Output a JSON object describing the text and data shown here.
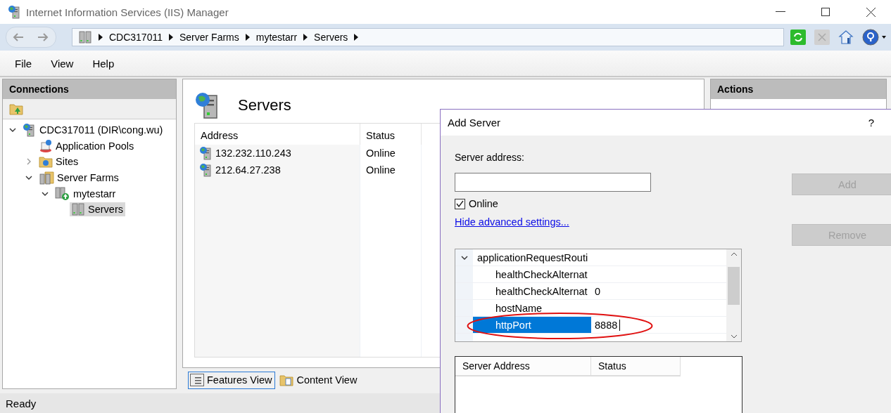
{
  "window": {
    "title": "Internet Information Services (IIS) Manager"
  },
  "breadcrumb": [
    "CDC317011",
    "Server Farms",
    "mytestarr",
    "Servers"
  ],
  "menu": [
    "File",
    "View",
    "Help"
  ],
  "connections": {
    "title": "Connections",
    "tree": [
      {
        "label": "CDC317011 (DIR\\cong.wu)",
        "kind": "server",
        "expanded": true,
        "selected": false,
        "children": [
          {
            "label": "Application Pools",
            "kind": "pools",
            "selected": false
          },
          {
            "label": "Sites",
            "kind": "sites",
            "expanded": false,
            "selected": false
          },
          {
            "label": "Server Farms",
            "kind": "farms",
            "expanded": true,
            "selected": false,
            "children": [
              {
                "label": "mytestarr",
                "kind": "farm",
                "expanded": true,
                "selected": false,
                "children": [
                  {
                    "label": "Servers",
                    "kind": "servers",
                    "selected": true
                  }
                ]
              }
            ]
          }
        ]
      }
    ]
  },
  "page": {
    "title": "Servers",
    "columns": [
      "Address",
      "Status"
    ],
    "rows": [
      {
        "address": "132.232.110.243",
        "status": "Online"
      },
      {
        "address": "212.64.27.238",
        "status": "Online"
      }
    ],
    "view_tabs": [
      {
        "label": "Features View",
        "selected": true
      },
      {
        "label": "Content View",
        "selected": false
      }
    ]
  },
  "actions": {
    "title": "Actions"
  },
  "status_bar": "Ready",
  "dialog": {
    "title": "Add Server",
    "help": "?",
    "address_label": "Server address:",
    "online": {
      "label": "Online",
      "checked": true
    },
    "link": "Hide advanced settings...",
    "properties": [
      {
        "kind": "group",
        "name": "applicationRequestRouti",
        "expanded": true,
        "selected": false
      },
      {
        "kind": "property",
        "name": "healthCheckAlternat",
        "selected": false
      },
      {
        "kind": "property",
        "name": "healthCheckAlternat",
        "value": "0",
        "selected": false
      },
      {
        "kind": "property",
        "name": "hostName",
        "selected": false
      },
      {
        "kind": "property",
        "name": "httpPort",
        "value": "8888",
        "selected": true
      }
    ],
    "buttons": [
      {
        "label": "Add",
        "disabled": true
      },
      {
        "label": "Remove",
        "disabled": true
      }
    ],
    "list_columns": [
      "Server Address",
      "Status"
    ]
  }
}
